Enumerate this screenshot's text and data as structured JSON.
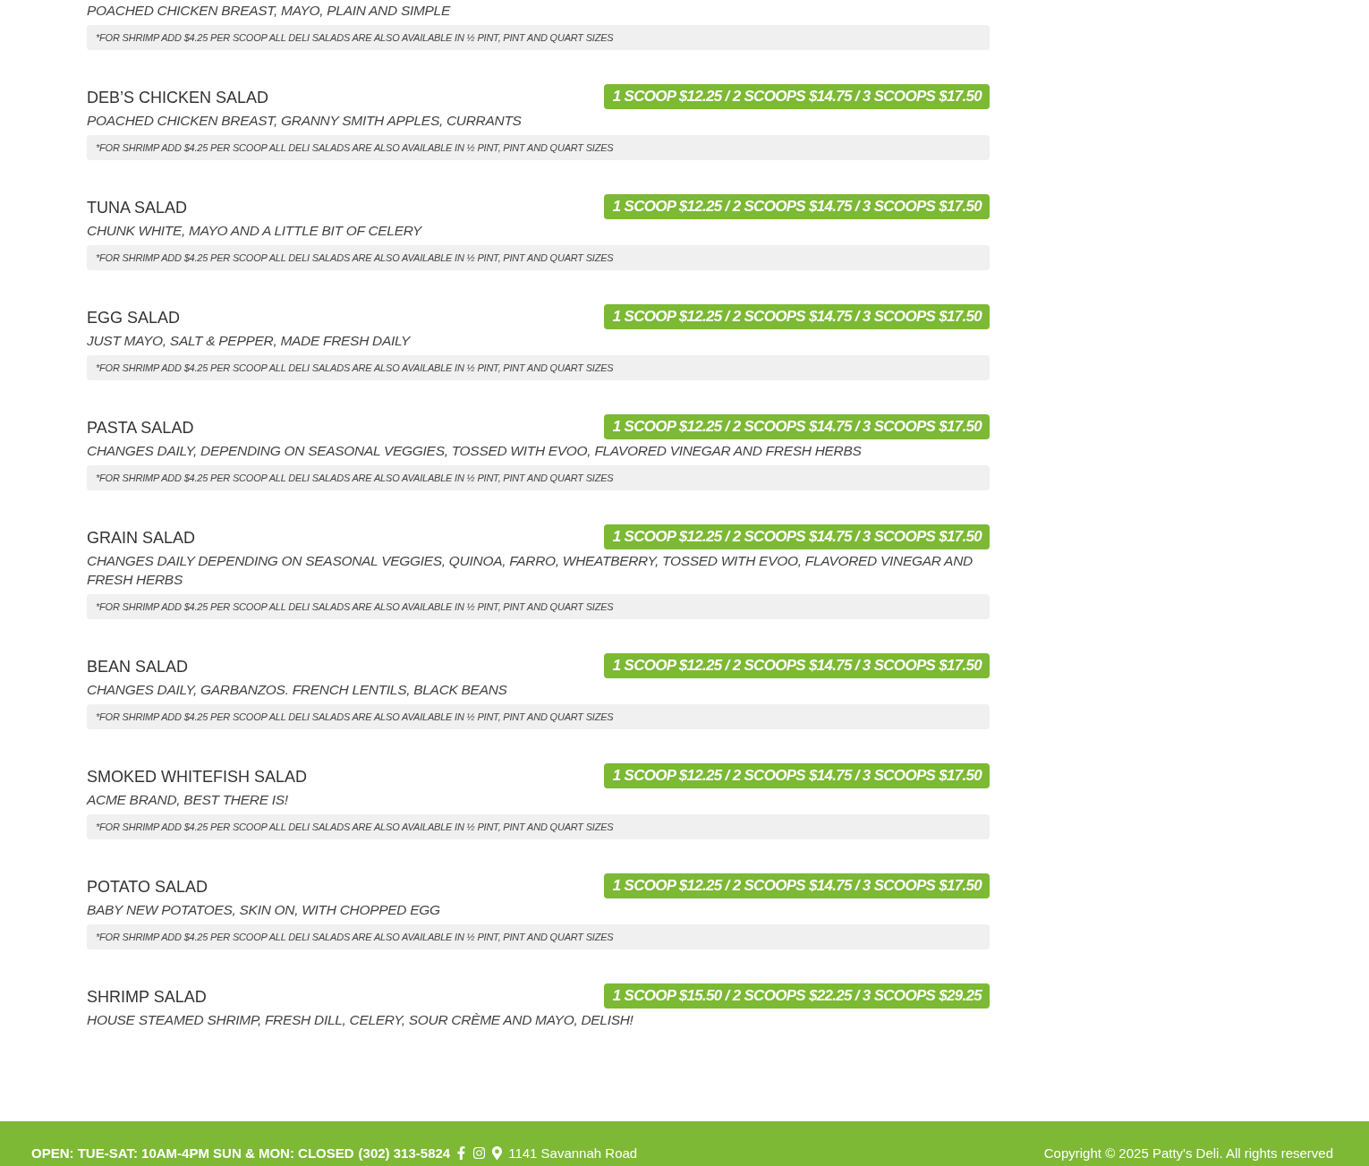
{
  "menu_items": [
    {
      "description": "POACHED CHICKEN BREAST, MAYO, PLAIN AND SIMPLE",
      "note": "*FOR SHRIMP ADD $4.25 PER SCOOP ALL DELI SALADS ARE ALSO AVAILABLE IN ½ PINT, PINT AND QUART SIZES"
    },
    {
      "name": "DEB’S CHICKEN SALAD",
      "price": "1 SCOOP $12.25 / 2 SCOOPS $14.75 / 3 SCOOPS $17.50",
      "description": "POACHED CHICKEN BREAST, GRANNY SMITH APPLES, CURRANTS",
      "note": "*FOR SHRIMP ADD $4.25 PER SCOOP ALL DELI SALADS ARE ALSO AVAILABLE IN ½ PINT, PINT AND QUART SIZES"
    },
    {
      "name": "TUNA SALAD",
      "price": "1 SCOOP $12.25 / 2 SCOOPS $14.75 / 3 SCOOPS $17.50",
      "description": "CHUNK WHITE, MAYO AND A LITTLE BIT OF CELERY",
      "note": "*FOR SHRIMP ADD $4.25 PER SCOOP ALL DELI SALADS ARE ALSO AVAILABLE IN ½ PINT, PINT AND QUART SIZES"
    },
    {
      "name": "EGG SALAD",
      "price": "1 SCOOP $12.25 / 2 SCOOPS $14.75 / 3 SCOOPS $17.50",
      "description": "JUST MAYO, SALT & PEPPER, MADE FRESH DAILY",
      "note": "*FOR SHRIMP ADD $4.25 PER SCOOP ALL DELI SALADS ARE ALSO AVAILABLE IN ½ PINT, PINT AND QUART SIZES"
    },
    {
      "name": "PASTA SALAD",
      "price": "1 SCOOP $12.25 / 2 SCOOPS $14.75 / 3 SCOOPS $17.50",
      "description": "CHANGES DAILY, DEPENDING ON SEASONAL VEGGIES, TOSSED WITH EVOO, FLAVORED VINEGAR AND FRESH HERBS",
      "note": "*FOR SHRIMP ADD $4.25 PER SCOOP ALL DELI SALADS ARE ALSO AVAILABLE IN ½ PINT, PINT AND QUART SIZES"
    },
    {
      "name": "GRAIN SALAD",
      "price": "1 SCOOP $12.25 / 2 SCOOPS $14.75 / 3 SCOOPS $17.50",
      "description": "CHANGES DAILY DEPENDING ON SEASONAL VEGGIES, QUINOA, FARRO, WHEATBERRY, TOSSED WITH EVOO, FLAVORED VINEGAR AND FRESH HERBS",
      "note": "*FOR SHRIMP ADD $4.25 PER SCOOP ALL DELI SALADS ARE ALSO AVAILABLE IN ½ PINT, PINT AND QUART SIZES"
    },
    {
      "name": "BEAN SALAD",
      "price": "1 SCOOP $12.25 / 2 SCOOPS $14.75 / 3 SCOOPS $17.50",
      "description": "CHANGES DAILY, GARBANZOS. FRENCH LENTILS, BLACK BEANS",
      "note": "*FOR SHRIMP ADD $4.25 PER SCOOP ALL DELI SALADS ARE ALSO AVAILABLE IN ½ PINT, PINT AND QUART SIZES"
    },
    {
      "name": "SMOKED WHITEFISH SALAD",
      "price": "1 SCOOP $12.25 / 2 SCOOPS $14.75 / 3 SCOOPS $17.50",
      "description": "ACME BRAND, BEST THERE IS!",
      "note": "*FOR SHRIMP ADD $4.25 PER SCOOP ALL DELI SALADS ARE ALSO AVAILABLE IN ½ PINT, PINT AND QUART SIZES"
    },
    {
      "name": "POTATO SALAD",
      "price": "1 SCOOP $12.25 / 2 SCOOPS $14.75 / 3 SCOOPS $17.50",
      "description": "BABY NEW POTATOES, SKIN ON, WITH CHOPPED EGG",
      "note": "*FOR SHRIMP ADD $4.25 PER SCOOP ALL DELI SALADS ARE ALSO AVAILABLE IN ½ PINT, PINT AND QUART SIZES"
    },
    {
      "name": "SHRIMP SALAD",
      "price": "1 SCOOP $15.50 / 2 SCOOPS $22.25 / 3 SCOOPS $29.25",
      "description": "HOUSE STEAMED SHRIMP, FRESH DILL, CELERY, SOUR CRÈME AND MAYO, DELISH!"
    }
  ],
  "footer": {
    "hours": "OPEN: TUE-SAT: 10AM-4PM SUN & MON: CLOSED",
    "phone": "(302) 313-5824",
    "address": "1141 Savannah Road",
    "copyright": "Copyright © 2025 Patty's Deli. All rights reserved"
  }
}
